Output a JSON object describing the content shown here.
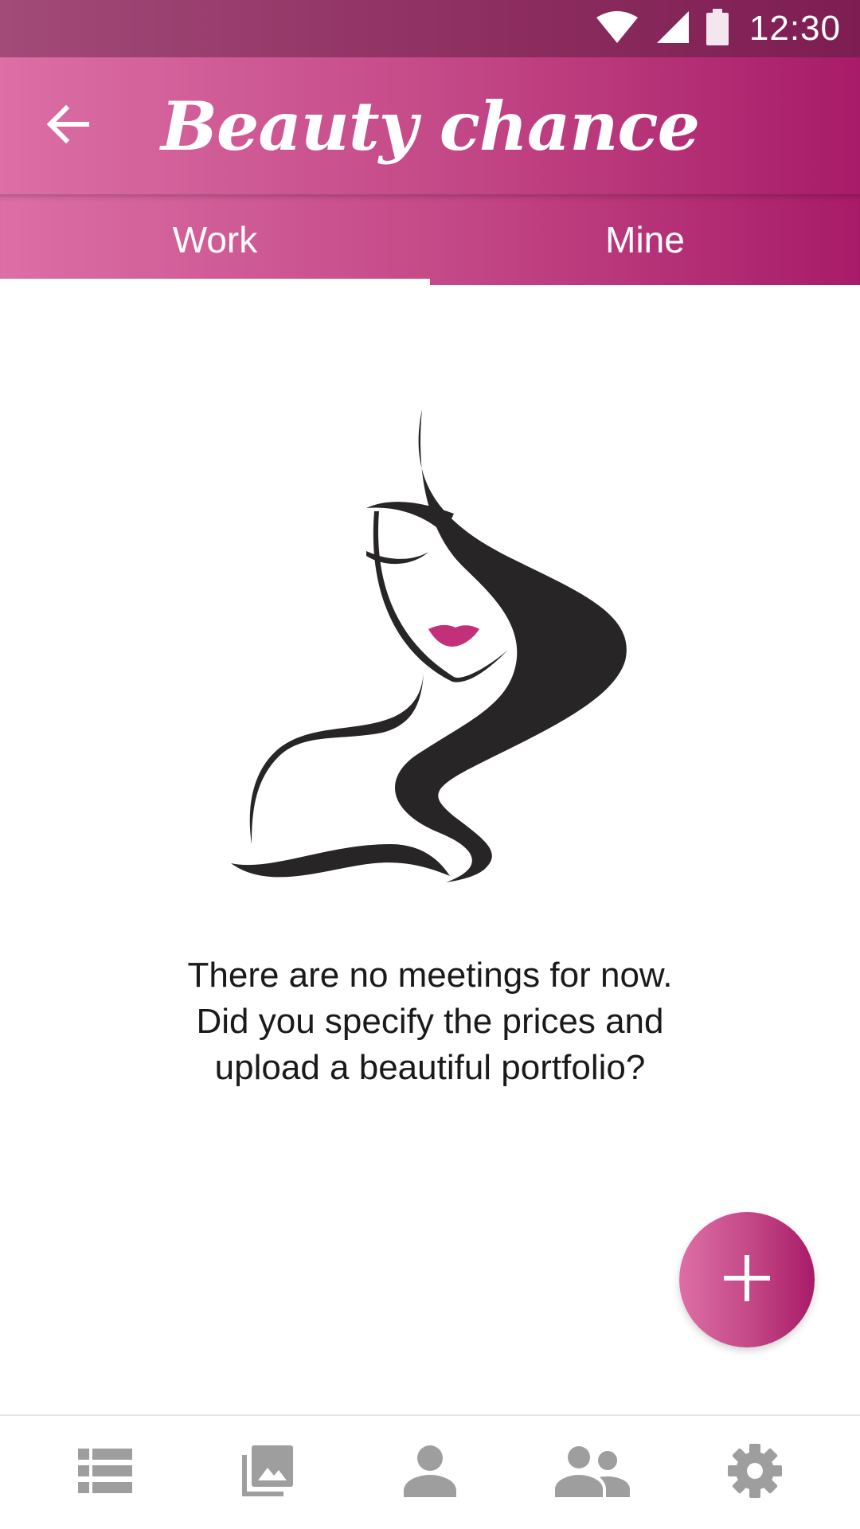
{
  "status_bar": {
    "time": "12:30",
    "icons": [
      "wifi-icon",
      "cellular-signal-icon",
      "battery-icon"
    ]
  },
  "app_bar": {
    "title": "Beauty chance",
    "back_icon": "arrow-left-icon"
  },
  "tabs": [
    {
      "label": "Work",
      "selected": true
    },
    {
      "label": "Mine",
      "selected": false
    }
  ],
  "empty_state": {
    "illustration": "woman-silhouette-illustration",
    "message_lines": [
      "There are no meetings for now.",
      "Did you specify the prices and",
      "upload a beautiful portfolio?"
    ]
  },
  "fab": {
    "icon": "plus-icon"
  },
  "bottom_nav": [
    {
      "icon": "list-icon"
    },
    {
      "icon": "photo-library-icon"
    },
    {
      "icon": "person-icon"
    },
    {
      "icon": "people-icon"
    },
    {
      "icon": "settings-gear-icon"
    }
  ],
  "colors": {
    "gradient_start": "#dc6fa5",
    "gradient_end": "#a81b68",
    "status_bar": "#8c2d5f",
    "nav_icon": "#9e9e9e",
    "text": "#1a1a1a",
    "lips": "#c2307a"
  }
}
